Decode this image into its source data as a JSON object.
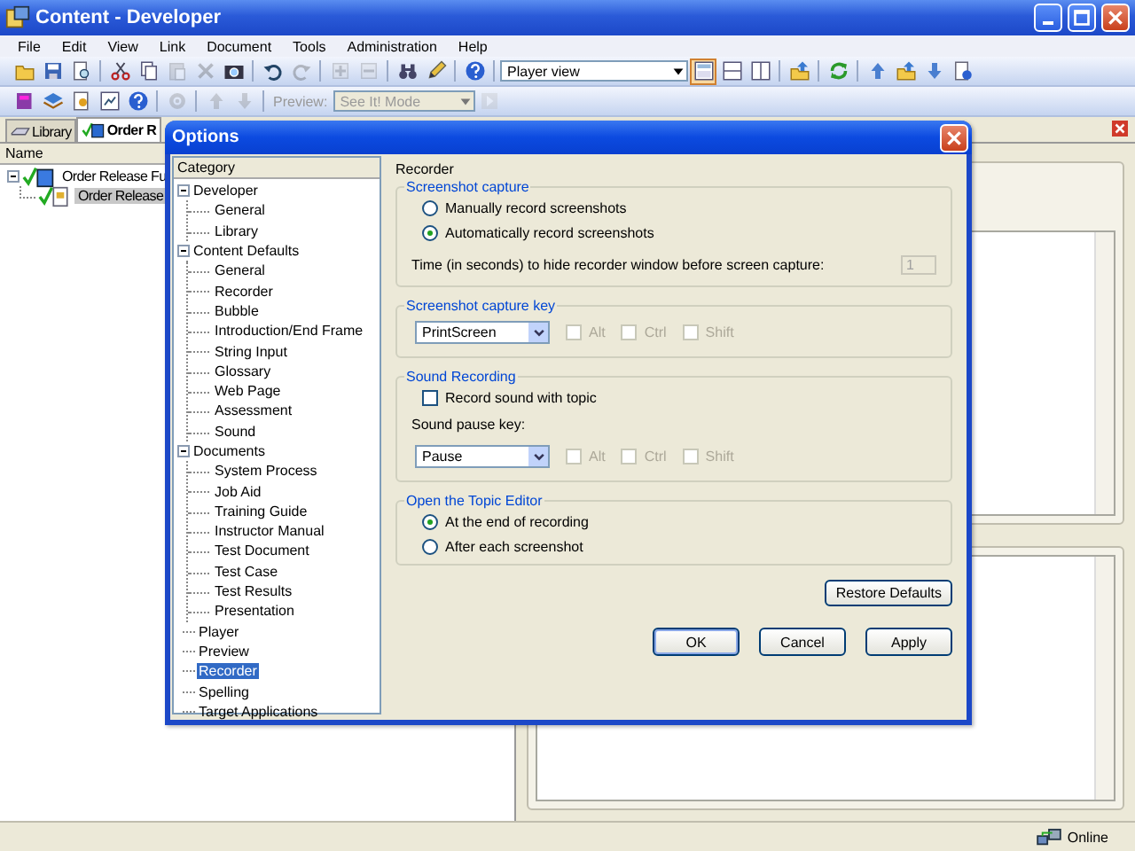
{
  "window": {
    "title": "Content - Developer"
  },
  "menu": [
    "File",
    "Edit",
    "View",
    "Link",
    "Document",
    "Tools",
    "Administration",
    "Help"
  ],
  "toolbar_1": {
    "items": [
      {
        "kind": "button",
        "disabled": false,
        "selected": false
      },
      {
        "kind": "button",
        "disabled": false,
        "selected": false
      },
      {
        "kind": "button",
        "disabled": false,
        "selected": false
      },
      {
        "kind": "separator"
      },
      {
        "kind": "button",
        "disabled": false,
        "selected": false
      },
      {
        "kind": "button",
        "disabled": false,
        "selected": false
      },
      {
        "kind": "button",
        "disabled": true,
        "selected": false
      },
      {
        "kind": "button",
        "disabled": true,
        "selected": false
      },
      {
        "kind": "button",
        "disabled": false,
        "selected": false
      },
      {
        "kind": "separator"
      },
      {
        "kind": "button",
        "disabled": false,
        "selected": false
      },
      {
        "kind": "button",
        "disabled": true,
        "selected": false
      },
      {
        "kind": "separator"
      },
      {
        "kind": "button",
        "disabled": true,
        "selected": false
      },
      {
        "kind": "button",
        "disabled": true,
        "selected": false
      },
      {
        "kind": "separator"
      },
      {
        "kind": "button",
        "disabled": false,
        "selected": false
      },
      {
        "kind": "button",
        "disabled": false,
        "selected": false
      },
      {
        "kind": "separator"
      },
      {
        "kind": "button",
        "disabled": false,
        "selected": false
      },
      {
        "kind": "separator"
      },
      {
        "kind": "select",
        "value": "Player view",
        "disabled": false
      },
      {
        "kind": "button",
        "disabled": false,
        "selected": true
      },
      {
        "kind": "button",
        "disabled": false,
        "selected": false
      },
      {
        "kind": "button",
        "disabled": false,
        "selected": false
      },
      {
        "kind": "separator"
      },
      {
        "kind": "button",
        "disabled": false,
        "selected": false
      },
      {
        "kind": "separator"
      },
      {
        "kind": "button",
        "disabled": false,
        "selected": false
      },
      {
        "kind": "separator"
      },
      {
        "kind": "button",
        "disabled": false,
        "selected": false
      },
      {
        "kind": "button",
        "disabled": false,
        "selected": false
      },
      {
        "kind": "button",
        "disabled": false,
        "selected": false
      },
      {
        "kind": "button",
        "disabled": false,
        "selected": false
      }
    ]
  },
  "toolbar_2": {
    "items": [
      {
        "kind": "button",
        "disabled": false,
        "selected": false
      },
      {
        "kind": "button",
        "disabled": false,
        "selected": false
      },
      {
        "kind": "button",
        "disabled": false,
        "selected": false
      },
      {
        "kind": "button",
        "disabled": false,
        "selected": false
      },
      {
        "kind": "button",
        "disabled": false,
        "selected": false
      },
      {
        "kind": "separator"
      },
      {
        "kind": "button",
        "disabled": true,
        "selected": false
      },
      {
        "kind": "separator"
      },
      {
        "kind": "button",
        "disabled": true,
        "selected": false
      },
      {
        "kind": "button",
        "disabled": true,
        "selected": false
      },
      {
        "kind": "separator"
      },
      {
        "kind": "label",
        "text": "Preview:",
        "disabled": true
      },
      {
        "kind": "select",
        "value": "See It! Mode",
        "disabled": true
      },
      {
        "kind": "button",
        "disabled": true,
        "selected": false
      }
    ]
  },
  "tabs": [
    {
      "label": "Library",
      "selected": false
    },
    {
      "label": "Order R",
      "selected": true
    }
  ],
  "outline": {
    "column": "Name",
    "items": [
      {
        "label": "Order Release Fu",
        "expanded": true,
        "selected": false,
        "children": [
          {
            "label": "Order Release",
            "selected": true
          }
        ]
      }
    ]
  },
  "dialog": {
    "title": "Options",
    "category_header": "Category",
    "categories": [
      {
        "label": "Developer",
        "expanded": true,
        "selected": false,
        "children": [
          {
            "label": "General",
            "selected": false
          },
          {
            "label": "Library",
            "selected": false
          }
        ]
      },
      {
        "label": "Content Defaults",
        "expanded": true,
        "selected": false,
        "children": [
          {
            "label": "General",
            "selected": false
          },
          {
            "label": "Recorder",
            "selected": false
          },
          {
            "label": "Bubble",
            "selected": false
          },
          {
            "label": "Introduction/End Frame",
            "selected": false
          },
          {
            "label": "String Input",
            "selected": false
          },
          {
            "label": "Glossary",
            "selected": false
          },
          {
            "label": "Web Page",
            "selected": false
          },
          {
            "label": "Assessment",
            "selected": false
          },
          {
            "label": "Sound",
            "selected": false
          }
        ]
      },
      {
        "label": "Documents",
        "expanded": true,
        "selected": false,
        "children": [
          {
            "label": "System Process",
            "selected": false
          },
          {
            "label": "Job Aid",
            "selected": false
          },
          {
            "label": "Training Guide",
            "selected": false
          },
          {
            "label": "Instructor Manual",
            "selected": false
          },
          {
            "label": "Test Document",
            "selected": false
          },
          {
            "label": "Test Case",
            "selected": false
          },
          {
            "label": "Test Results",
            "selected": false
          },
          {
            "label": "Presentation",
            "selected": false
          }
        ]
      },
      {
        "label": "Player",
        "expanded": false,
        "selected": false
      },
      {
        "label": "Preview",
        "expanded": false,
        "selected": false
      },
      {
        "label": "Recorder",
        "expanded": false,
        "selected": true
      },
      {
        "label": "Spelling",
        "expanded": false,
        "selected": false
      },
      {
        "label": "Target Applications",
        "expanded": false,
        "selected": false
      }
    ],
    "page_title": "Recorder",
    "groups": [
      {
        "title": "Screenshot capture",
        "rows": [
          {
            "kind": "radio",
            "label": "Manually record screenshots",
            "selected": false
          },
          {
            "kind": "radio",
            "label": "Automatically record screenshots",
            "selected": true
          },
          {
            "kind": "field",
            "label": "Time (in seconds) to hide recorder window before screen capture:",
            "value": "1",
            "disabled": true
          }
        ]
      },
      {
        "title": "Screenshot capture key",
        "rows": [
          {
            "kind": "keys",
            "value": "PrintScreen",
            "modifiers": [
              {
                "label": "Alt",
                "checked": false,
                "disabled": true
              },
              {
                "label": "Ctrl",
                "checked": false,
                "disabled": true
              },
              {
                "label": "Shift",
                "checked": false,
                "disabled": true
              }
            ]
          }
        ]
      },
      {
        "title": "Sound Recording",
        "rows": [
          {
            "kind": "checkbox",
            "label": "Record sound with topic",
            "checked": false,
            "disabled": false
          },
          {
            "kind": "text",
            "label": "Sound pause key:"
          },
          {
            "kind": "keys",
            "value": "Pause",
            "modifiers": [
              {
                "label": "Alt",
                "checked": false,
                "disabled": true
              },
              {
                "label": "Ctrl",
                "checked": false,
                "disabled": true
              },
              {
                "label": "Shift",
                "checked": false,
                "disabled": true
              }
            ]
          }
        ]
      },
      {
        "title": "Open the Topic Editor",
        "rows": [
          {
            "kind": "radio",
            "label": "At the end of recording",
            "selected": true
          },
          {
            "kind": "radio",
            "label": "After each screenshot",
            "selected": false
          }
        ]
      }
    ],
    "restore_button": "Restore Defaults",
    "buttons": [
      {
        "label": "OK",
        "default": true
      },
      {
        "label": "Cancel",
        "default": false
      },
      {
        "label": "Apply",
        "default": false
      }
    ]
  },
  "status_bar": {
    "connection": "Online"
  }
}
